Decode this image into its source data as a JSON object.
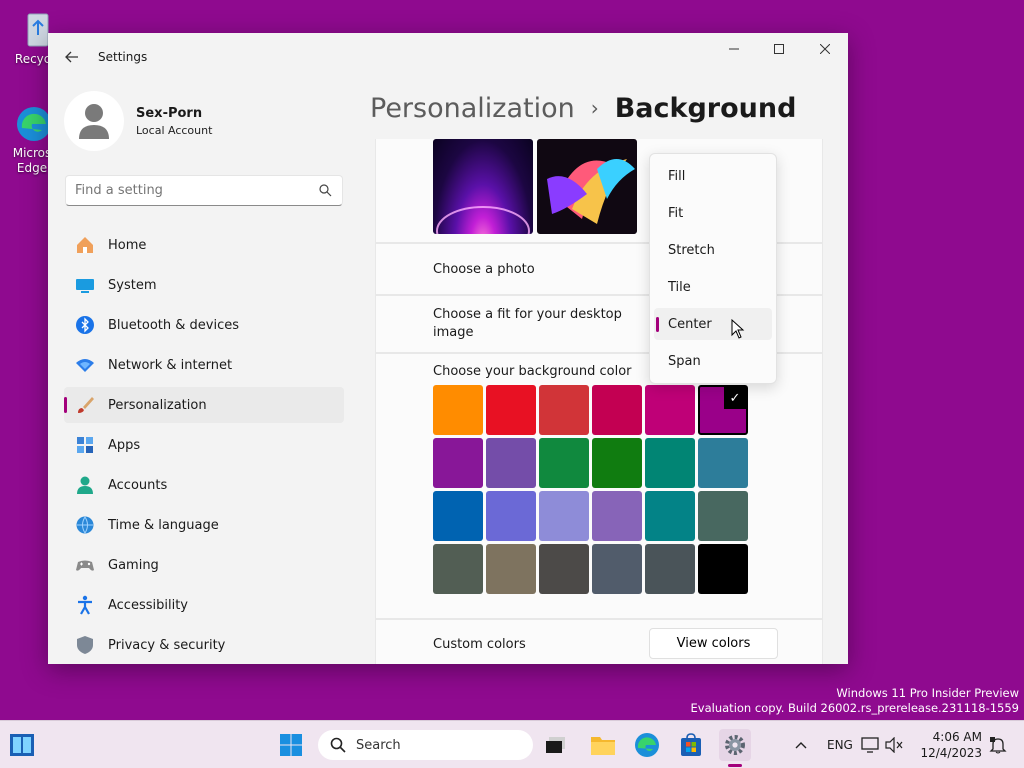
{
  "desktop": {
    "icons": [
      {
        "label": "Recycle"
      },
      {
        "label": "Micros Edge"
      }
    ]
  },
  "window": {
    "title": "Settings",
    "account": {
      "name": "Sex-Porn",
      "type": "Local Account"
    },
    "search": {
      "placeholder": "Find a setting"
    },
    "nav": [
      {
        "label": "Home",
        "icon": "home-icon"
      },
      {
        "label": "System",
        "icon": "system-icon"
      },
      {
        "label": "Bluetooth & devices",
        "icon": "bluetooth-icon"
      },
      {
        "label": "Network & internet",
        "icon": "network-icon"
      },
      {
        "label": "Personalization",
        "icon": "brush-icon",
        "active": true
      },
      {
        "label": "Apps",
        "icon": "apps-icon"
      },
      {
        "label": "Accounts",
        "icon": "accounts-icon"
      },
      {
        "label": "Time & language",
        "icon": "globe-icon"
      },
      {
        "label": "Gaming",
        "icon": "gamepad-icon"
      },
      {
        "label": "Accessibility",
        "icon": "accessibility-icon"
      },
      {
        "label": "Privacy & security",
        "icon": "shield-icon"
      }
    ],
    "breadcrumb": {
      "parent": "Personalization",
      "separator": "›",
      "current": "Background"
    },
    "rows": {
      "choose_photo": "Choose a photo",
      "choose_fit": "Choose a fit for your desktop image",
      "bg_color": "Choose your background color",
      "custom_colors": "Custom colors",
      "view_colors": "View colors"
    },
    "fit_options": [
      {
        "label": "Fill"
      },
      {
        "label": "Fit"
      },
      {
        "label": "Stretch"
      },
      {
        "label": "Tile"
      },
      {
        "label": "Center",
        "active": true
      },
      {
        "label": "Span"
      }
    ],
    "colors": [
      "#ff8c00",
      "#e81123",
      "#d13438",
      "#c30052",
      "#bf0077",
      "#9a0089",
      "#881798",
      "#744da9",
      "#10893e",
      "#107c10",
      "#018574",
      "#2d7d9a",
      "#0063b1",
      "#6b69d6",
      "#8e8cd8",
      "#8764b8",
      "#038387",
      "#486860",
      "#525e54",
      "#7e735f",
      "#4c4a48",
      "#515c6b",
      "#4a5459",
      "#000000"
    ],
    "selected_color": 5,
    "accent": "#a3007b"
  },
  "watermark": {
    "line1": "Windows 11 Pro Insider Preview",
    "line2": "Evaluation copy. Build 26002.rs_prerelease.231118-1559"
  },
  "taskbar": {
    "search_label": "Search",
    "language": "ENG",
    "time": "4:06 AM",
    "date": "12/4/2023"
  }
}
